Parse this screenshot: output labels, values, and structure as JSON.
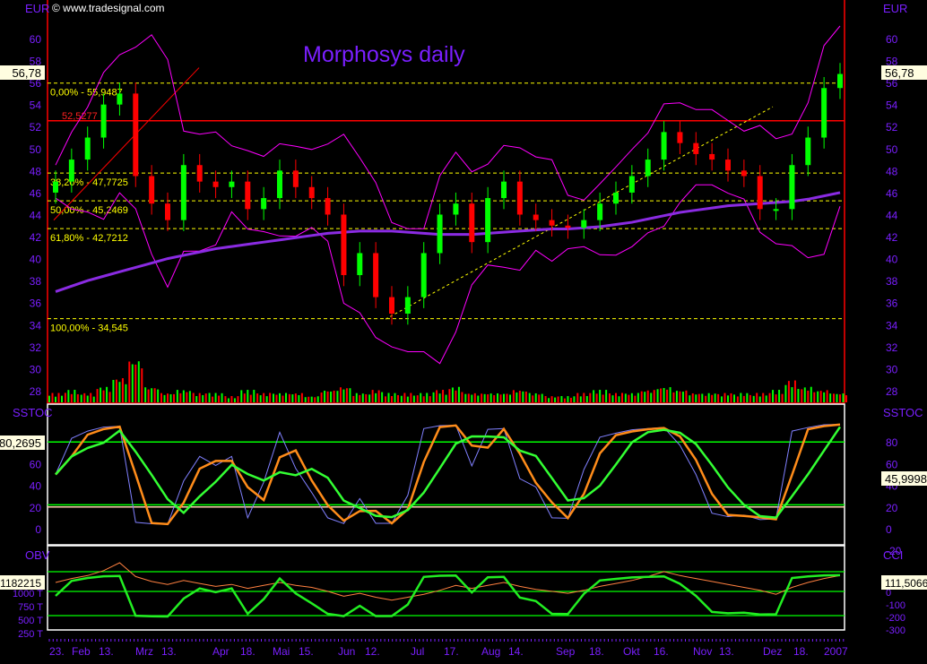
{
  "copyright": "© www.tradesignal.com",
  "chart_data": {
    "type": "candlestick",
    "title": "Morphosys daily",
    "currency_label": "EUR",
    "last_price_label": "56,78",
    "ylim": [
      27,
      62
    ],
    "y_ticks": [
      60,
      58,
      56,
      54,
      52,
      50,
      48,
      46,
      44,
      42,
      40,
      38,
      36,
      34,
      32,
      30,
      28
    ],
    "x": [
      "2006-01-23",
      "2006-01-30",
      "2006-02-06",
      "2006-02-13",
      "2006-02-20",
      "2006-02-27",
      "2006-03-06",
      "2006-03-13",
      "2006-03-20",
      "2006-03-27",
      "2006-04-03",
      "2006-04-10",
      "2006-04-17",
      "2006-04-24",
      "2006-05-01",
      "2006-05-08",
      "2006-05-15",
      "2006-05-22",
      "2006-05-29",
      "2006-06-05",
      "2006-06-12",
      "2006-06-19",
      "2006-06-26",
      "2006-07-03",
      "2006-07-10",
      "2006-07-17",
      "2006-07-24",
      "2006-07-31",
      "2006-08-07",
      "2006-08-14",
      "2006-08-21",
      "2006-08-28",
      "2006-09-04",
      "2006-09-11",
      "2006-09-18",
      "2006-09-25",
      "2006-10-02",
      "2006-10-09",
      "2006-10-16",
      "2006-10-23",
      "2006-10-30",
      "2006-11-06",
      "2006-11-13",
      "2006-11-20",
      "2006-11-27",
      "2006-12-04",
      "2006-12-11",
      "2006-12-18",
      "2006-12-25",
      "2007-01-01"
    ],
    "close": [
      47,
      49,
      51,
      54,
      55,
      47.5,
      45,
      43.5,
      48.5,
      47,
      46.5,
      47,
      44.5,
      45.5,
      48,
      46.5,
      45.5,
      44,
      38.5,
      40.5,
      36.5,
      35,
      36.5,
      40.5,
      44,
      45,
      41.5,
      45.5,
      47,
      44,
      43.5,
      43,
      42.8,
      43.5,
      45,
      46,
      47.5,
      49,
      51.5,
      50.5,
      49.5,
      49,
      48,
      47.5,
      44.5,
      44.5,
      48.5,
      51,
      55.5,
      56.78
    ],
    "moving_average": [
      37,
      37.5,
      38,
      38.4,
      38.8,
      39.2,
      39.6,
      40,
      40.3,
      40.6,
      40.9,
      41.1,
      41.3,
      41.5,
      41.7,
      41.9,
      42.1,
      42.3,
      42.4,
      42.5,
      42.5,
      42.5,
      42.4,
      42.3,
      42.2,
      42.2,
      42.2,
      42.3,
      42.4,
      42.5,
      42.6,
      42.7,
      42.7,
      42.8,
      42.9,
      43.1,
      43.3,
      43.6,
      43.9,
      44.2,
      44.4,
      44.6,
      44.8,
      44.9,
      45,
      45.1,
      45.2,
      45.4,
      45.7,
      46
    ],
    "volume_relative": [
      3,
      4,
      3,
      5,
      8,
      14,
      5,
      3,
      4,
      3,
      3,
      2,
      4,
      3,
      3,
      3,
      2,
      4,
      5,
      3,
      4,
      3,
      3,
      3,
      4,
      5,
      3,
      3,
      3,
      4,
      3,
      2,
      2,
      3,
      4,
      3,
      3,
      4,
      5,
      4,
      3,
      3,
      3,
      3,
      3,
      4,
      7,
      5,
      4,
      3
    ],
    "fibonacci": [
      {
        "label": "0,00% - 55,9487",
        "value": 55.9487
      },
      {
        "label": "38,20% - 47,7725",
        "value": 47.7725
      },
      {
        "label": "50,00% - 45,2469",
        "value": 45.2469
      },
      {
        "label": "61,80% - 42,7212",
        "value": 42.7212
      },
      {
        "label": "100,00% - 34,545",
        "value": 34.545
      }
    ],
    "resistance": {
      "label": "52,5277",
      "value": 52.5277
    },
    "x_tick_labels": [
      "23.",
      "Feb",
      "13.",
      "Mrz",
      "13.",
      "Apr",
      "18.",
      "Mai",
      "15.",
      "Jun",
      "12.",
      "Jul",
      "17.",
      "Aug",
      "14.",
      "Sep",
      "18.",
      "Okt",
      "16.",
      "Nov",
      "13.",
      "Dez",
      "18.",
      "2007"
    ],
    "sstoc": {
      "label": "SSTOC",
      "left_marker": "80,2695",
      "right_marker": "45,9998",
      "left_ticks": [
        "80",
        "60",
        "40",
        "20",
        "0"
      ],
      "right_ticks": [
        "80",
        "60",
        "40",
        "20",
        "0",
        "-20"
      ],
      "levels": [
        80,
        20
      ],
      "ylim": [
        -25,
        105
      ]
    },
    "obv": {
      "label": "OBV",
      "left_marker": "1182215",
      "left_ticks": [
        "1000 T",
        "750 T",
        "500 T",
        "250 T"
      ]
    },
    "cci": {
      "label": "CCI",
      "right_marker": "111,5066",
      "right_ticks": [
        "0",
        "-100",
        "-200",
        "-300"
      ]
    },
    "colors": {
      "up": "#00ff00",
      "down": "#ff0000",
      "ma": "#8a2be2",
      "bands": "#ff00ff",
      "fib": "#ffff00",
      "axis": "#7a1fff",
      "sstoc_orange": "#ff8c1a",
      "sstoc_blue": "#8080ff"
    }
  }
}
